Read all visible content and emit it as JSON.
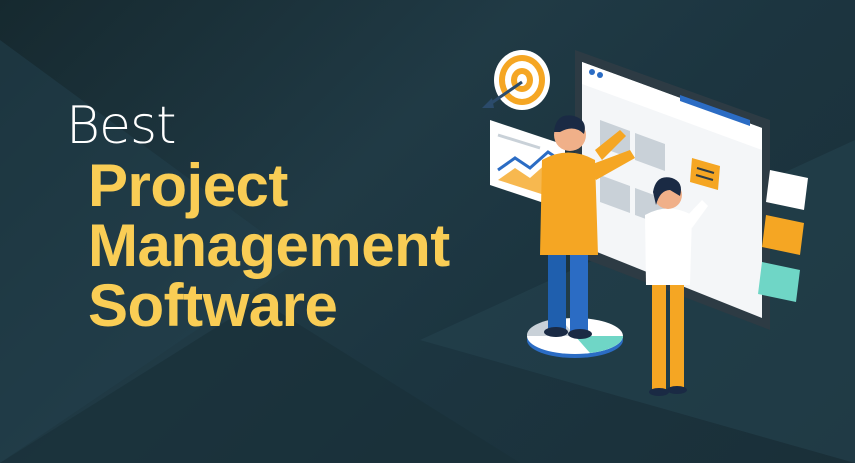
{
  "headline": {
    "line1": "Best",
    "line2": "Project",
    "line3": "Management",
    "line4": "Software"
  },
  "colors": {
    "background": "#1e3440",
    "accent_yellow": "#f9cd55",
    "orange": "#f5a623",
    "blue": "#2b6cc4",
    "white": "#ffffff",
    "teal": "#6fd6c6"
  },
  "icons": [
    "target-icon",
    "arrow-icon",
    "sticky-note-icon",
    "chart-icon"
  ]
}
